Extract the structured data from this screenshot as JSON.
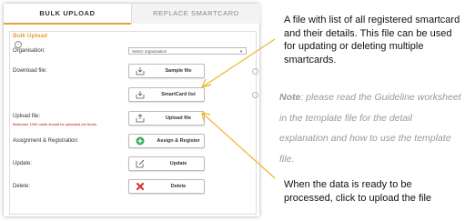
{
  "tabs": {
    "bulk_upload": "BULK UPLOAD",
    "replace_smartcard": "REPLACE SMARTCARD"
  },
  "section": {
    "title": "Bulk Upload"
  },
  "fields": {
    "organisation_label": "Organisation:",
    "organisation_placeholder": "Select organisation",
    "download_label": "Download file:",
    "upload_label": "Upload file:",
    "upload_limit_note": "Maximum 1000 cards should be uploaded per times.",
    "assign_label": "Assignment & Registration:",
    "update_label": "Update:",
    "delete_label": "Delete:"
  },
  "buttons": {
    "sample_file": "Sample file",
    "smartcard_list": "SmartCard list",
    "upload_file": "Upload file",
    "assign_register": "Assign & Register",
    "update": "Update",
    "delete": "Delete"
  },
  "annotations": {
    "file_desc": "A file with list of all registered smartcard and their details. This file can be used for updating or deleting multiple smartcards.",
    "note_label": "Note",
    "note_text": ": please read the Guideline worksheet in the template file for the detail explanation and how to use the template file.",
    "upload_desc": "When the data is ready to be processed, click to upload the file"
  },
  "colors": {
    "accent": "#e6a23c",
    "assign_green": "#3aaa5c",
    "delete_red": "#d9342b"
  }
}
